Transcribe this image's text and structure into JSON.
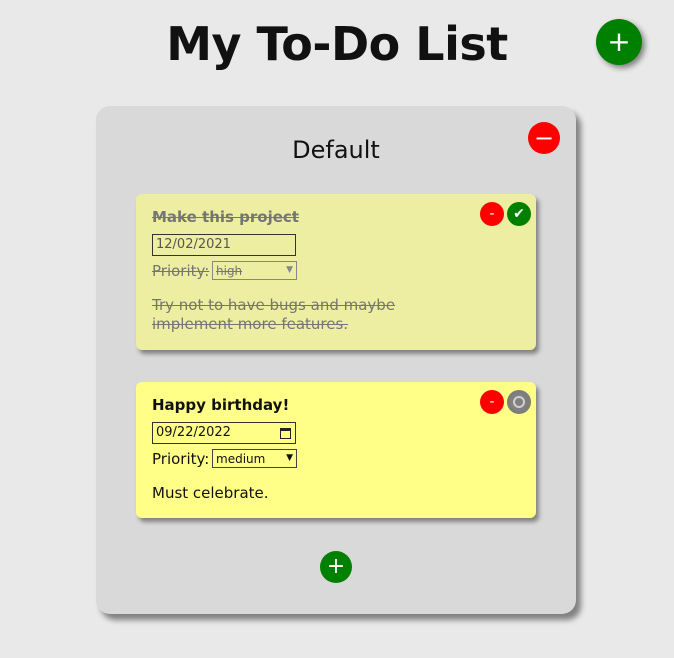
{
  "page": {
    "title": "My To-Do List",
    "add_list_label": "+"
  },
  "colors": {
    "page_bg": "#e9e9e9",
    "list_bg": "#d9d9d9",
    "add": "#008000",
    "delete": "#ff0000",
    "check_done": "#008000",
    "check_pending": "#808080",
    "todo_done_bg": "#eeeea2",
    "todo_pending_bg": "#ffff88"
  },
  "list": {
    "name": "Default",
    "delete_label": "−",
    "add_todo_label": "+",
    "todos": [
      {
        "title": "Make this project",
        "date": "12/02/2021",
        "priority_label": "Priority:",
        "priority": "high",
        "notes": "Try not to have bugs and maybe implement more features.",
        "completed": true,
        "delete_label": "-",
        "check_label": "✔"
      },
      {
        "title": "Happy birthday!",
        "date": "09/22/2022",
        "priority_label": "Priority:",
        "priority": "medium",
        "notes": "Must celebrate.",
        "completed": false,
        "delete_label": "-",
        "check_label": ""
      }
    ]
  }
}
